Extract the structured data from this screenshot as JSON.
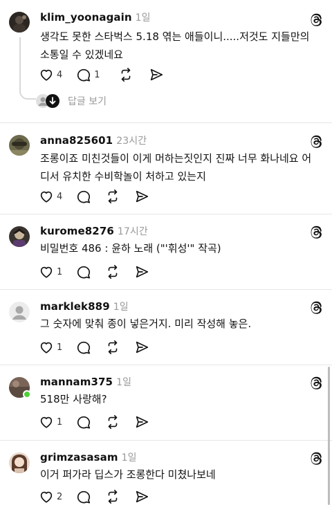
{
  "accent_online": "#4cd137",
  "posts": [
    {
      "username": "klim_yoonagain",
      "time": "1일",
      "text": "생각도 못한 스타벅스 5.18 엮는 애들이니.....저것도 지들만의 소통일 수 있겠네요",
      "likes": "4",
      "comments": "1",
      "view_replies": "답글 보기",
      "avatar_icon": "avatar-dark-icon"
    },
    {
      "username": "anna825601",
      "time": "23시간",
      "text": "조롱이죠 미친것들이 이게 머하는짓인지 진짜 너무 화나네요 어디서 유치한 수비학놀이 처하고 있는지",
      "likes": "4",
      "comments": "",
      "avatar_icon": "avatar-photo-icon"
    },
    {
      "username": "kurome8276",
      "time": "17시간",
      "text": "비밀번호 486 : 윤하 노래 (\"'휘성'\" 작곡)",
      "likes": "1",
      "comments": "",
      "avatar_icon": "avatar-character-icon"
    },
    {
      "username": "marklek889",
      "time": "1일",
      "text": "그 숫자에 맞춰 종이 넣은거지. 미리 작성해 놓은.",
      "likes": "1",
      "comments": "",
      "avatar_icon": "default-avatar-icon"
    },
    {
      "username": "mannam375",
      "time": "1일",
      "text": "518만 사랑해?",
      "likes": "1",
      "comments": "",
      "avatar_icon": "avatar-photo-icon"
    },
    {
      "username": "grimzasasam",
      "time": "1일",
      "text": "이거 퍼가라 딥스가 조롱한다 미쳤나보네",
      "likes": "2",
      "comments": "",
      "avatar_icon": "avatar-photo-icon"
    }
  ]
}
